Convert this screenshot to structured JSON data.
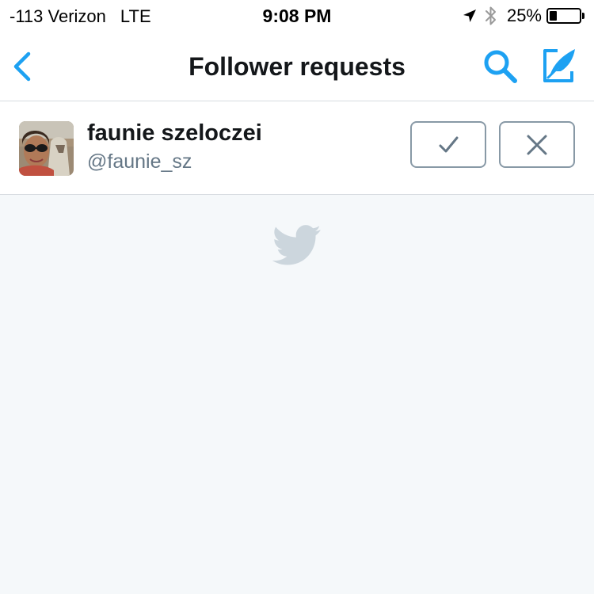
{
  "status_bar": {
    "carrier": "-113 Verizon",
    "network": "LTE",
    "time": "9:08 PM",
    "battery_percent": "25%",
    "battery_level": 0.25,
    "icons": [
      "location-arrow-icon",
      "bluetooth-icon",
      "battery-icon"
    ]
  },
  "nav": {
    "title": "Follower requests",
    "icons": [
      "back-chevron-icon",
      "search-icon",
      "compose-tweet-icon"
    ]
  },
  "requests": [
    {
      "name": "faunie szeloczei",
      "handle": "@faunie_sz",
      "accept_icon": "checkmark-icon",
      "decline_icon": "x-close-icon"
    }
  ],
  "empty_state": {
    "icon": "twitter-bird-icon"
  },
  "colors": {
    "accent": "#1da1f2",
    "background": "#f5f8fa",
    "text_primary": "#14171a",
    "text_secondary": "#657786",
    "border": "#8899a6",
    "bird": "#ccd6dd"
  }
}
